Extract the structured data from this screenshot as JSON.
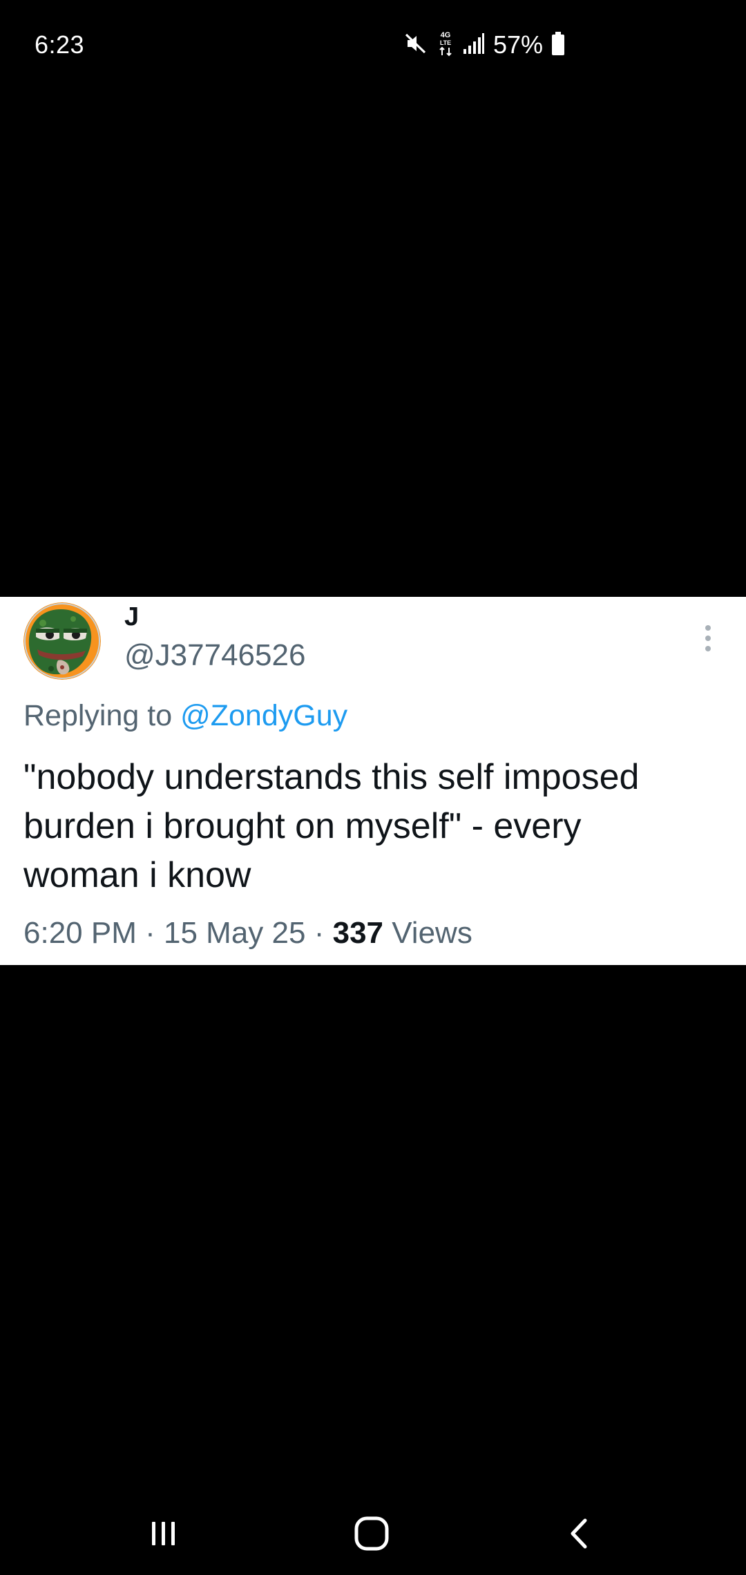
{
  "status_bar": {
    "time": "6:23",
    "battery_percent": "57%",
    "icons": [
      "mute-icon",
      "4g-lte-icon",
      "signal-icon",
      "battery-icon"
    ]
  },
  "tweet": {
    "display_name": "J",
    "handle": "@J37746526",
    "reply_prefix": "Replying to",
    "reply_mention": "@ZondyGuy",
    "text": "\"nobody understands this self imposed\nburden i brought on myself\" - every\nwoman i know",
    "time": "6:20 PM",
    "separator": "·",
    "date": "15 May 25",
    "views_count": "337",
    "views_label": "Views",
    "avatar_icon": "frog-avatar",
    "more_icon": "more-vertical-icon"
  },
  "nav_bar": {
    "icons": [
      "recent-apps-icon",
      "home-icon",
      "back-icon"
    ]
  },
  "colors": {
    "background": "#000000",
    "card": "#ffffff",
    "text_primary": "#0f1419",
    "text_secondary": "#536471",
    "link": "#1d9bf0",
    "avatar_ring": "#f7931e"
  }
}
